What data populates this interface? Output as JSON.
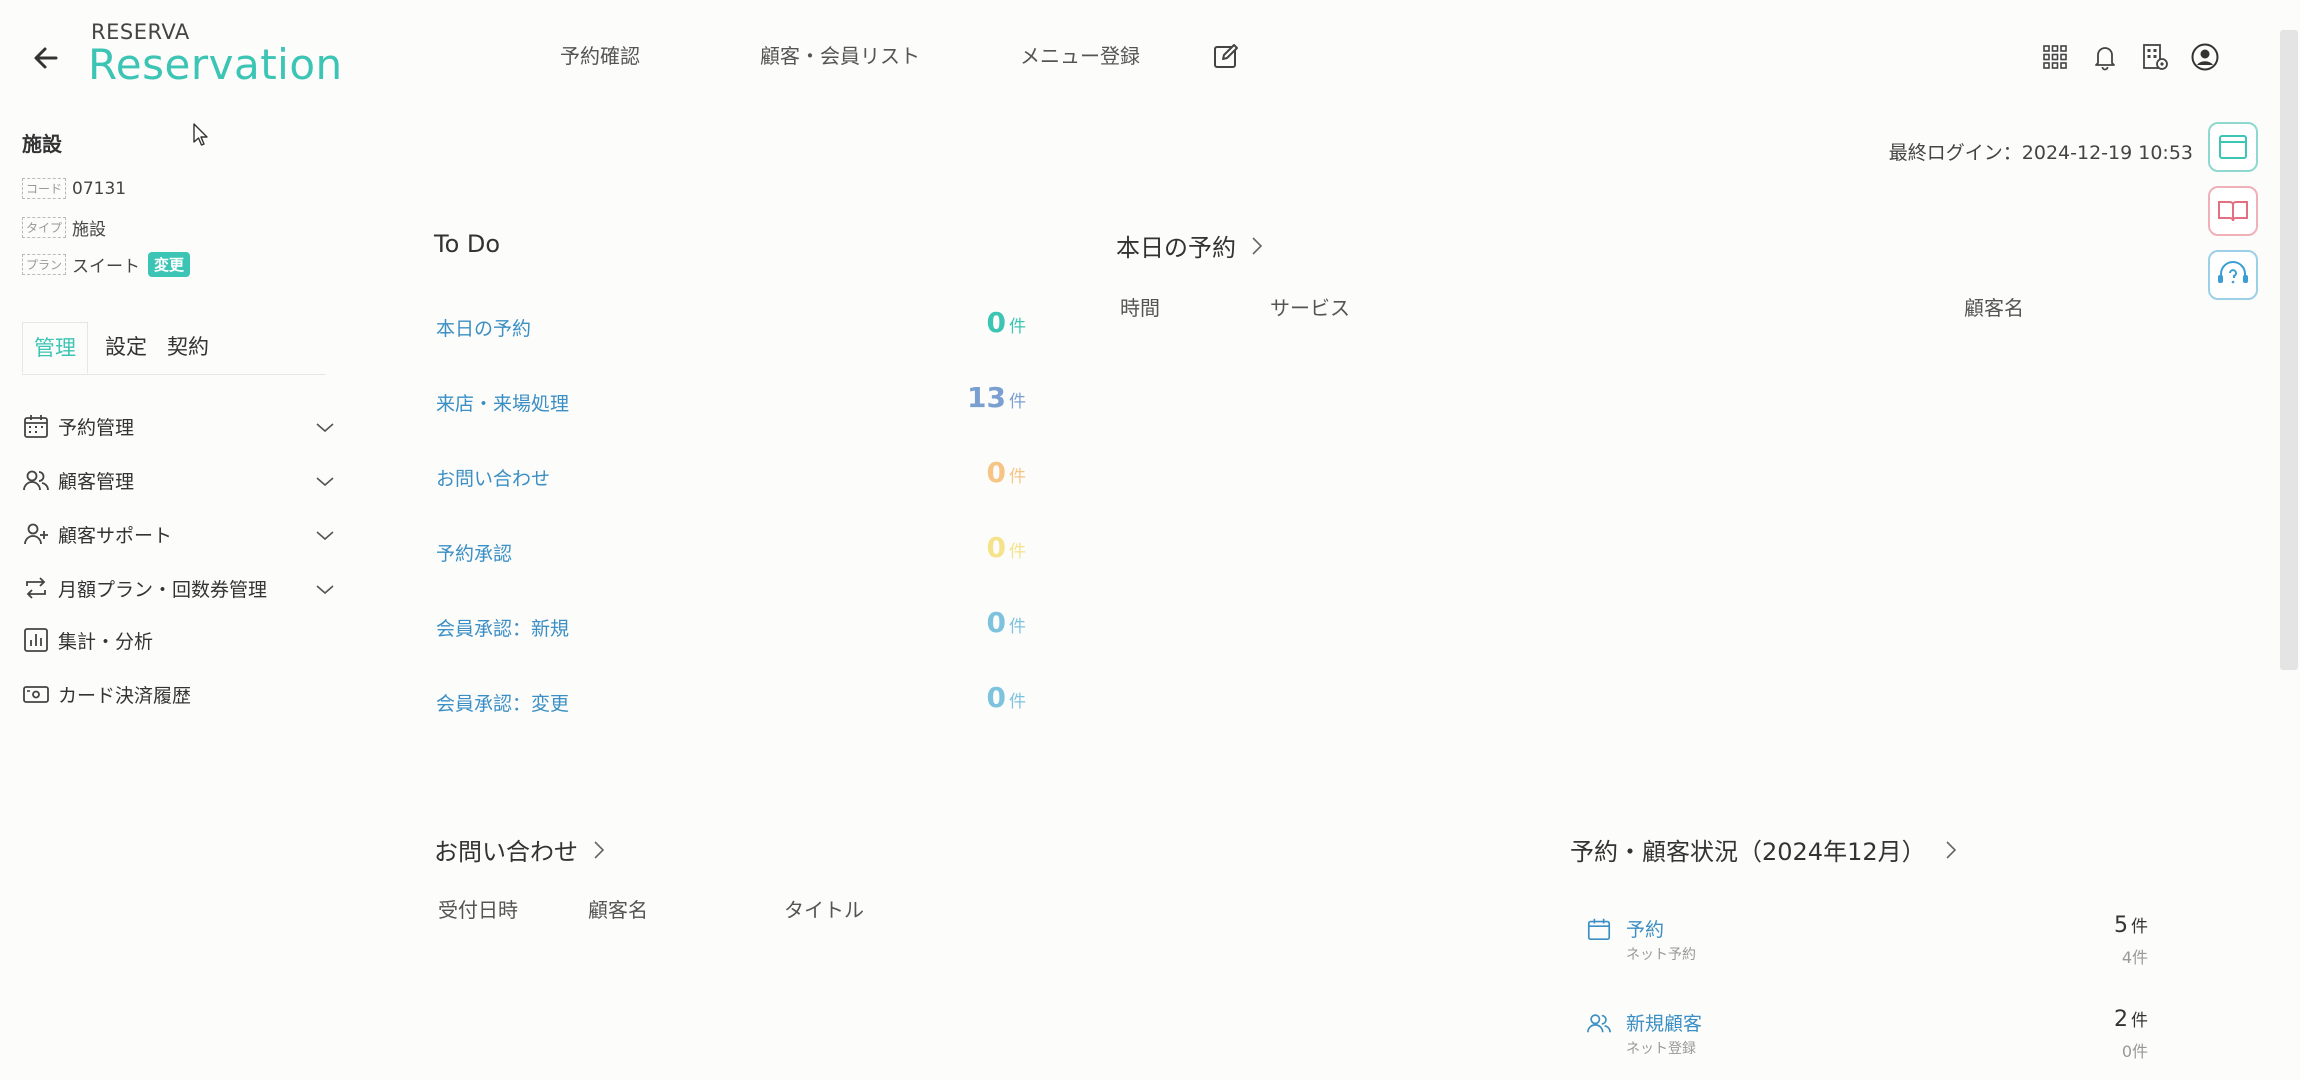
{
  "header": {
    "brand_small": "RESERVA",
    "brand_big": "Reservation",
    "nav": [
      "予約確認",
      "顧客・会員リスト",
      "メニュー登録"
    ]
  },
  "last_login": "最終ログイン：2024-12-19 10:53",
  "facility": {
    "title": "施設",
    "code_tag": "コード",
    "code": "07131",
    "type_tag": "タイプ",
    "type": "施設",
    "plan_tag": "プラン",
    "plan": "スイート",
    "change_label": "変更"
  },
  "tabs": [
    "管理",
    "設定",
    "契約"
  ],
  "sidebar": {
    "items": [
      {
        "label": "予約管理",
        "icon": "calendar-icon",
        "expandable": true
      },
      {
        "label": "顧客管理",
        "icon": "users-icon",
        "expandable": true
      },
      {
        "label": "顧客サポート",
        "icon": "user-plus-icon",
        "expandable": true
      },
      {
        "label": "月額プラン・回数券管理",
        "icon": "repeat-icon",
        "expandable": true
      },
      {
        "label": "集計・分析",
        "icon": "chart-icon",
        "expandable": false
      },
      {
        "label": "カード決済履歴",
        "icon": "card-icon",
        "expandable": false
      }
    ]
  },
  "todo": {
    "title": "To Do",
    "unit": "件",
    "items": [
      {
        "label": "本日の予約",
        "value": "0",
        "color": "#3cc4b4"
      },
      {
        "label": "来店・来場処理",
        "value": "13",
        "color": "#7a9fd0"
      },
      {
        "label": "お問い合わせ",
        "value": "0",
        "color": "#f6c585"
      },
      {
        "label": "予約承認",
        "value": "0",
        "color": "#f4e38a"
      },
      {
        "label": "会員承認：新規",
        "value": "0",
        "color": "#7ec3de"
      },
      {
        "label": "会員承認：変更",
        "value": "0",
        "color": "#7ec3de"
      }
    ]
  },
  "today": {
    "title": "本日の予約",
    "columns": [
      "時間",
      "サービス",
      "顧客名"
    ]
  },
  "inquiry": {
    "title": "お問い合わせ",
    "columns": [
      "受付日時",
      "顧客名",
      "タイトル"
    ]
  },
  "status": {
    "title": "予約・顧客状況（2024年12月）",
    "unit": "件",
    "items": [
      {
        "label": "予約",
        "sub": "ネット予約",
        "value": "5",
        "subvalue": "4件",
        "icon": "calendar-icon"
      },
      {
        "label": "新規顧客",
        "sub": "ネット登録",
        "value": "2",
        "subvalue": "0件",
        "icon": "users-icon"
      }
    ]
  },
  "colors": {
    "accent": "#3cc4b4",
    "link": "#3b8fc4"
  }
}
